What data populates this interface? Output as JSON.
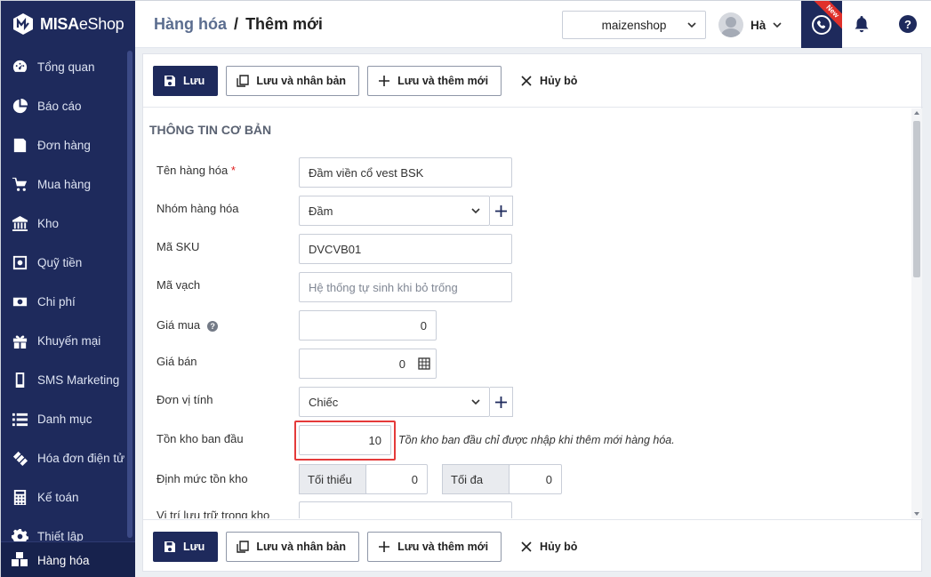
{
  "app": {
    "logo_brand": "MISA",
    "logo_product": "eShop"
  },
  "sidebar": {
    "items": [
      {
        "label": "Tổng quan",
        "icon": "dashboard-icon"
      },
      {
        "label": "Báo cáo",
        "icon": "pie-chart-icon"
      },
      {
        "label": "Đơn hàng",
        "icon": "order-icon"
      },
      {
        "label": "Mua hàng",
        "icon": "cart-icon"
      },
      {
        "label": "Kho",
        "icon": "warehouse-icon"
      },
      {
        "label": "Quỹ tiền",
        "icon": "safe-icon"
      },
      {
        "label": "Chi phí",
        "icon": "money-icon"
      },
      {
        "label": "Khuyến mại",
        "icon": "gift-icon"
      },
      {
        "label": "SMS Marketing",
        "icon": "phone-icon"
      },
      {
        "label": "Danh mục",
        "icon": "list-icon"
      },
      {
        "label": "Hóa đơn điện tử",
        "icon": "invoice-icon"
      },
      {
        "label": "Kế toán",
        "icon": "calculator-icon"
      },
      {
        "label": "Thiết lập",
        "icon": "gear-icon"
      }
    ],
    "active_item": {
      "label": "Hàng hóa",
      "icon": "boxes-icon"
    }
  },
  "header": {
    "breadcrumb_parent": "Hàng hóa",
    "breadcrumb_separator": "/",
    "breadcrumb_current": "Thêm mới",
    "shop_name": "maizenshop",
    "user_name": "Hà",
    "new_badge": "New",
    "help_label": "?"
  },
  "toolbar": {
    "save": "Lưu",
    "save_duplicate": "Lưu và nhân bản",
    "save_add_new": "Lưu và thêm mới",
    "cancel": "Hủy bỏ"
  },
  "form": {
    "section_title": "THÔNG TIN CƠ BẢN",
    "product_name": {
      "label": "Tên hàng hóa",
      "required_mark": "*",
      "value": "Đầm viền cổ vest BSK"
    },
    "product_group": {
      "label": "Nhóm hàng hóa",
      "value": "Đầm"
    },
    "sku": {
      "label": "Mã SKU",
      "value": "DVCVB01"
    },
    "barcode": {
      "label": "Mã vạch",
      "placeholder": "Hệ thống tự sinh khi bỏ trống"
    },
    "purchase_price": {
      "label": "Giá mua",
      "help": "?",
      "value": "0"
    },
    "sale_price": {
      "label": "Giá bán",
      "value": "0"
    },
    "unit": {
      "label": "Đơn vị tính",
      "value": "Chiếc"
    },
    "opening_stock": {
      "label": "Tồn kho ban đầu",
      "value": "10",
      "hint": "Tồn kho ban đầu chỉ được nhập khi thêm mới hàng hóa."
    },
    "stock_limit": {
      "label": "Định mức tồn kho",
      "min_label": "Tối thiểu",
      "min_value": "0",
      "max_label": "Tối đa",
      "max_value": "0"
    },
    "storage_location": {
      "label": "Vị trí lưu trữ trong kho",
      "value": ""
    }
  },
  "colors": {
    "sidebar_bg": "#1e2a5c",
    "highlight": "#e43a3a",
    "badge": "#e0302b"
  }
}
